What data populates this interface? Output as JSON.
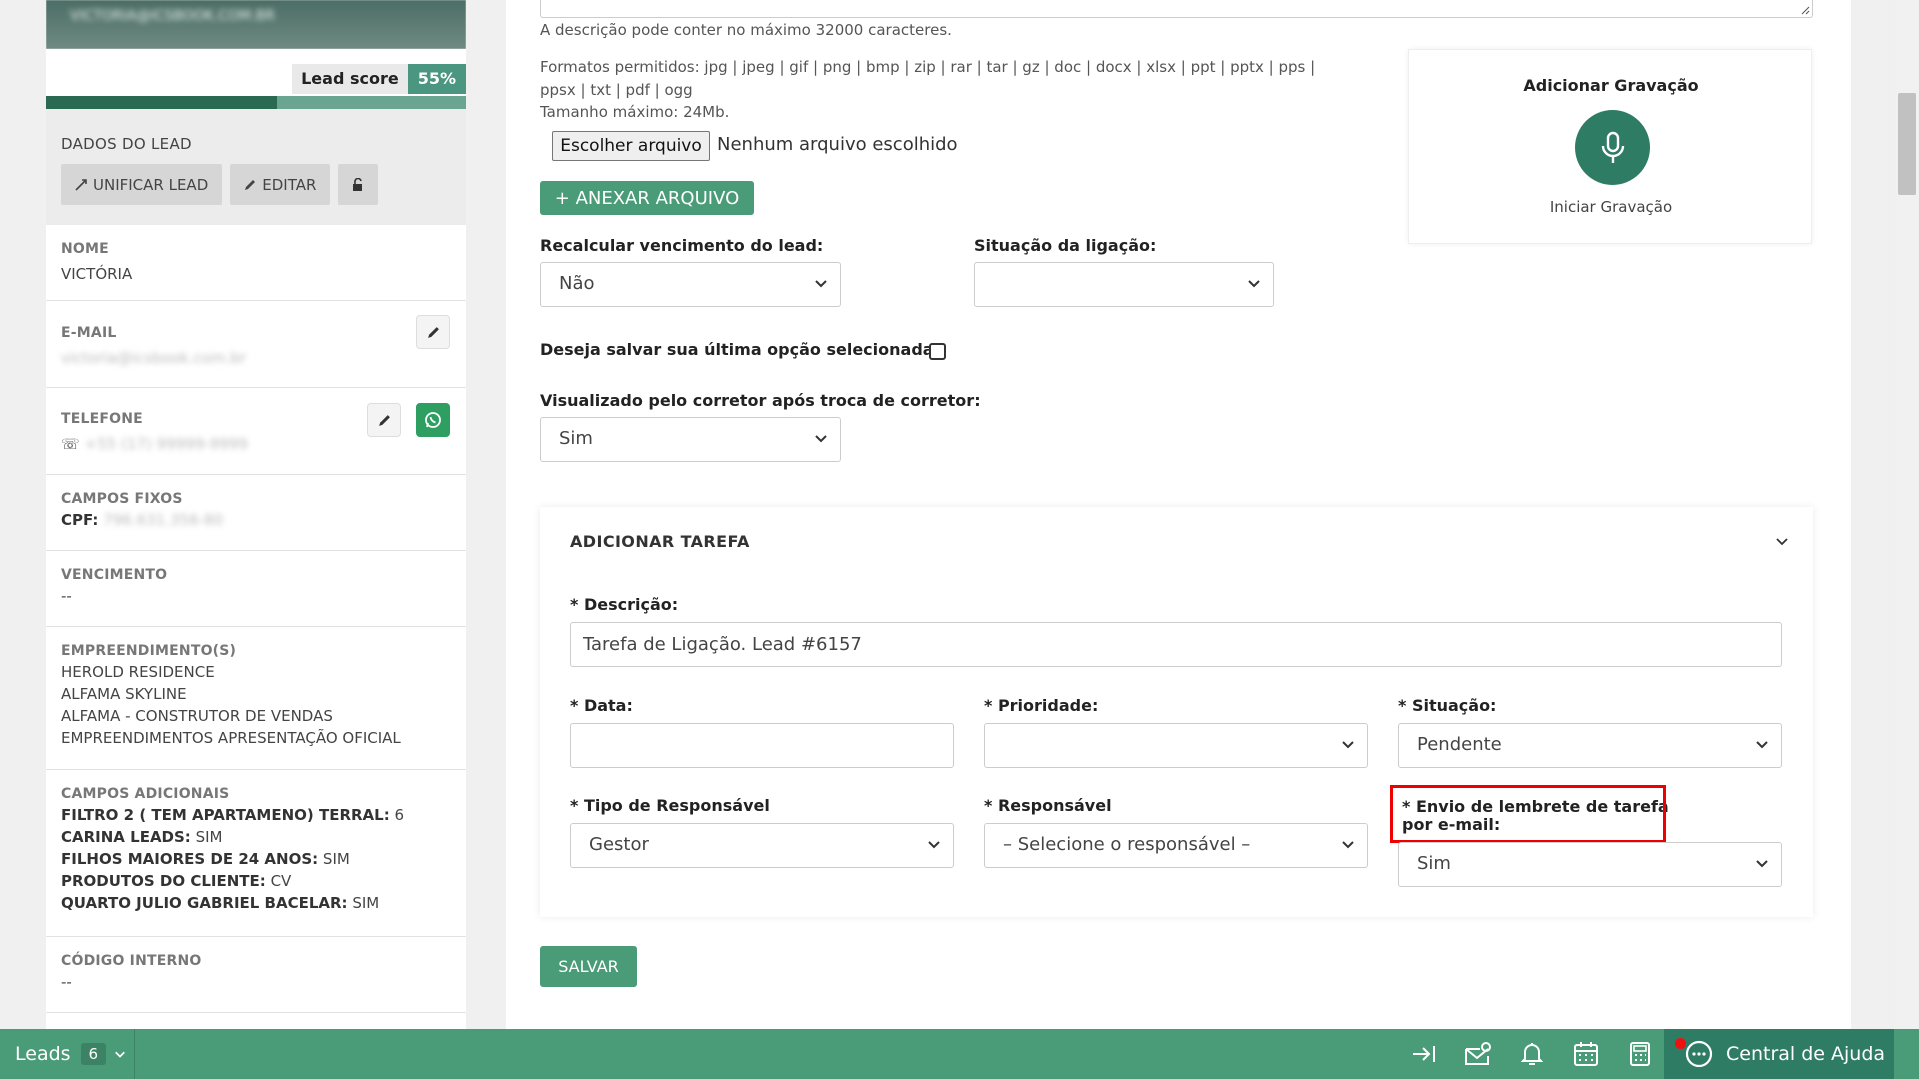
{
  "lead": {
    "header_name_blurred": "VICTORIA@ICSBOOK.COM.BR",
    "score_label": "Lead score",
    "score_value": "55%",
    "score_fraction": 0.55,
    "dados_title": "DADOS DO LEAD",
    "btn_unificar": "UNIFICAR LEAD",
    "btn_editar": "EDITAR",
    "nome_label": "NOME",
    "nome_value": "VICTÓRIA",
    "email_label": "E-MAIL",
    "email_value_blurred": "victoria@icsbook.com.br",
    "telefone_label": "TELEFONE",
    "telefone_value_blurred": "+55 (17) 99999-9999",
    "campos_fixos_label": "CAMPOS FIXOS",
    "cpf_key": "CPF:",
    "cpf_value_blurred": "796.631.356-80",
    "vencimento_label": "VENCIMENTO",
    "vencimento_value": "--",
    "empreendimentos_label": "EMPREENDIMENTO(S)",
    "empreendimentos": [
      "HEROLD RESIDENCE",
      "ALFAMA SKYLINE",
      "ALFAMA - CONSTRUTOR DE VENDAS",
      "EMPREENDIMENTOS APRESENTAÇÃO OFICIAL"
    ],
    "campos_adicionais_label": "CAMPOS ADICIONAIS",
    "campos_adicionais": [
      {
        "key": "FILTRO 2 ( TEM APARTAMENO) TERRAL:",
        "value": "6"
      },
      {
        "key": "CARINA LEADS:",
        "value": "SIM"
      },
      {
        "key": "FILHOS MAIORES DE 24 ANOS:",
        "value": "SIM"
      },
      {
        "key": "PRODUTOS DO CLIENTE:",
        "value": "CV"
      },
      {
        "key": "QUARTO JULIO GABRIEL BACELAR:",
        "value": "SIM"
      }
    ],
    "codigo_label": "CÓDIGO INTERNO",
    "codigo_value": "--"
  },
  "form": {
    "desc_limit": "A descrição pode conter no máximo 32000 caracteres.",
    "formatos_line1": "Formatos permitidos: jpg | jpeg | gif | png | bmp | zip | rar | tar | gz | doc | docx | xlsx | ppt | pptx | pps |",
    "formatos_line2": "ppsx | txt | pdf | ogg",
    "tamanho": "Tamanho máximo: 24Mb.",
    "escolher_btn": "Escolher arquivo",
    "nenhum_arquivo": "Nenhum arquivo escolhido",
    "anexar_btn": "+ ANEXAR ARQUIVO",
    "recalcular_label": "Recalcular vencimento do lead:",
    "recalcular_value": "Não",
    "situacao_lig_label": "Situação da ligação:",
    "situacao_lig_value": "",
    "salvar_opcao_label": "Deseja salvar sua última opção selecionada:",
    "visualizado_label": "Visualizado pelo corretor após troca de corretor:",
    "visualizado_value": "Sim",
    "gravacao_title": "Adicionar Gravação",
    "gravacao_btn": "Iniciar Gravação"
  },
  "task": {
    "title": "ADICIONAR TAREFA",
    "descricao_label": "* Descrição:",
    "descricao_value": "Tarefa de Ligação. Lead #6157",
    "data_label": "* Data:",
    "data_value": "",
    "prioridade_label": "* Prioridade:",
    "prioridade_value": "",
    "situacao_label": "* Situação:",
    "situacao_value": "Pendente",
    "tipo_resp_label": "* Tipo de Responsável",
    "tipo_resp_value": "Gestor",
    "responsavel_label": "* Responsável",
    "responsavel_value": "– Selecione o responsável –",
    "envio_label_1": "* Envio de lembrete de tarefa",
    "envio_label_2": "por e-mail:",
    "envio_value": "Sim",
    "salvar_btn": "SALVAR"
  },
  "bottom": {
    "leads_label": "Leads",
    "leads_count": "6",
    "help_label": "Central de Ajuda"
  },
  "colors": {
    "brand_green": "#4a9b78",
    "dark_green": "#2f7c65",
    "highlight_red": "#e00000"
  }
}
